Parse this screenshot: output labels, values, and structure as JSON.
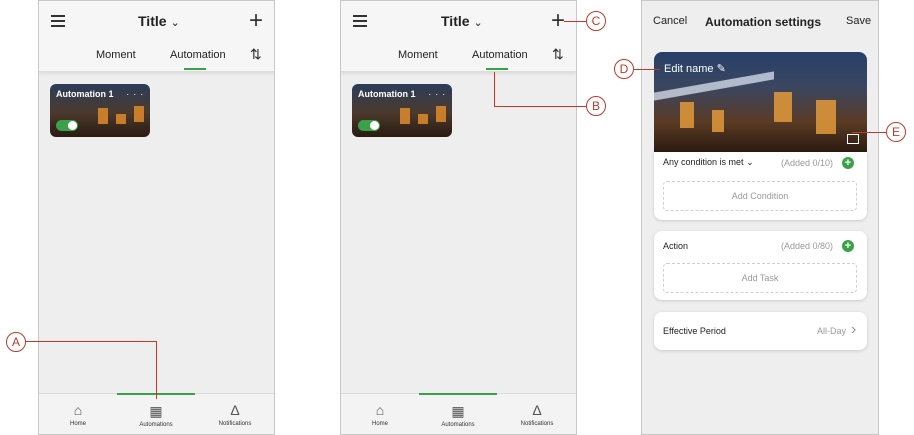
{
  "screen_a": {
    "title": "Title",
    "tabs": [
      "Moment",
      "Automation"
    ],
    "card_label": "Automation 1",
    "card_more": ". . .",
    "nav": [
      "Home",
      "Automations",
      "Notifications"
    ]
  },
  "screen_b": {
    "title": "Title",
    "tabs": [
      "Moment",
      "Automation"
    ],
    "card_label": "Automation 1",
    "card_more": ". . .",
    "nav": [
      "Home",
      "Automations",
      "Notifications"
    ]
  },
  "screen_c": {
    "cancel": "Cancel",
    "title": "Automation settings",
    "save": "Save",
    "edit_name": "Edit name",
    "condition_label": "Any condition is met",
    "condition_added": "(Added 0/10)",
    "add_condition": "Add Condition",
    "action_label": "Action",
    "action_added": "(Added 0/80)",
    "add_task": "Add Task",
    "effective_label": "Effective Period",
    "effective_value": "All-Day"
  },
  "callouts": [
    "A",
    "B",
    "C",
    "D",
    "E"
  ],
  "colors": {
    "accent": "#3aa14a",
    "callout": "#c0392b"
  },
  "icons": [
    "menu-icon",
    "chevron-down-icon",
    "plus-icon",
    "sort-icon",
    "home-icon",
    "automations-grid-icon",
    "bell-icon",
    "pencil-icon",
    "image-icon",
    "chevron-right-icon"
  ]
}
